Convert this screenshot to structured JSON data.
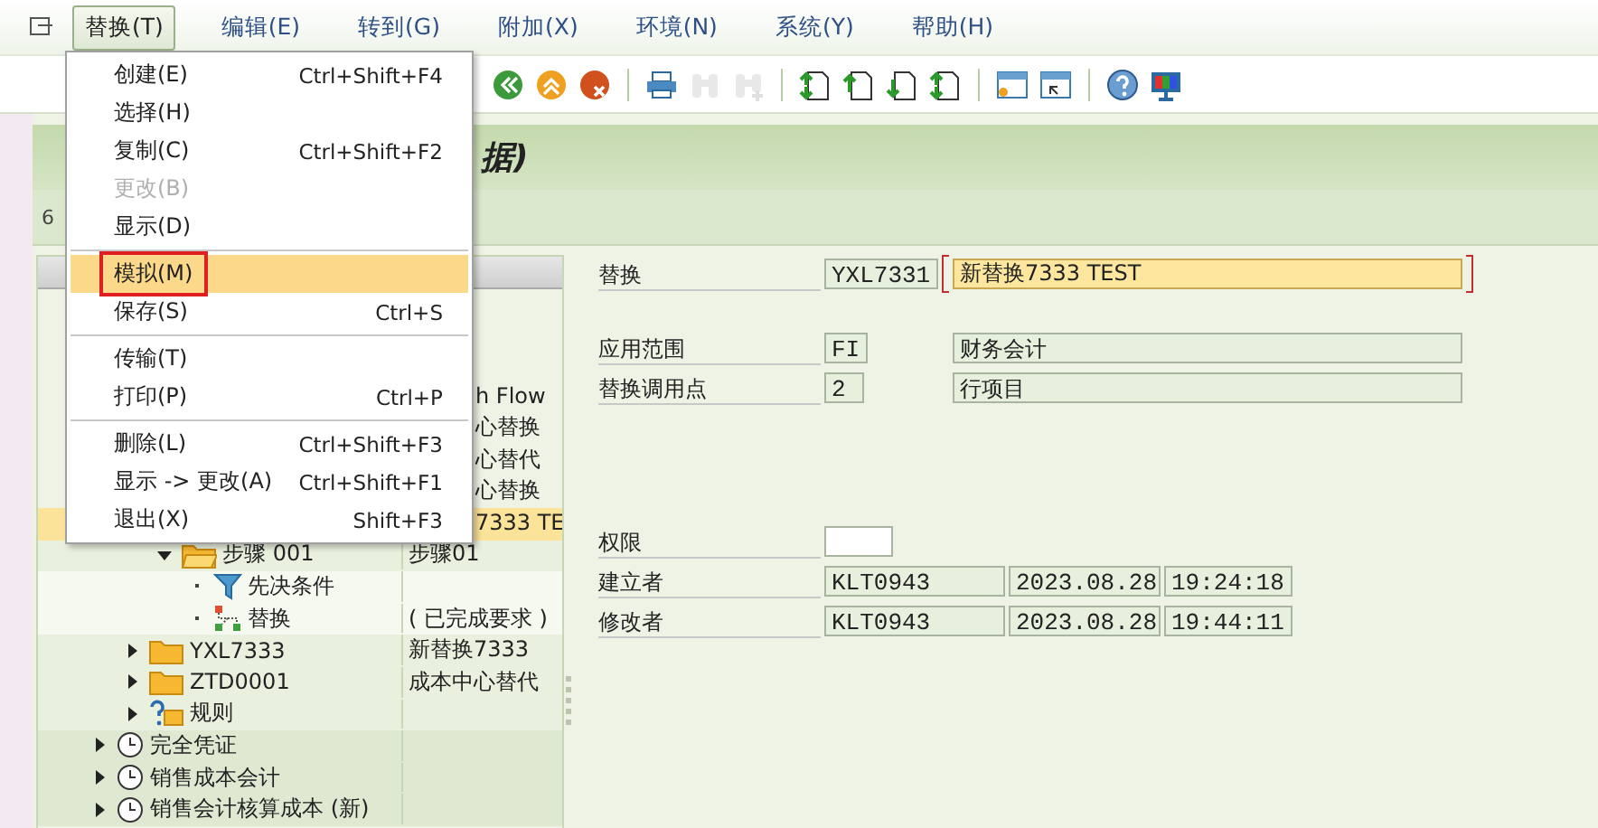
{
  "menu_bar": {
    "items": [
      {
        "label": "替换(T)",
        "selected": true
      },
      {
        "label": "编辑(E)",
        "selected": false
      },
      {
        "label": "转到(G)",
        "selected": false
      },
      {
        "label": "附加(X)",
        "selected": false
      },
      {
        "label": "环境(N)",
        "selected": false
      },
      {
        "label": "系统(Y)",
        "selected": false
      },
      {
        "label": "帮助(H)",
        "selected": false
      }
    ]
  },
  "toolbar": {
    "buttons": [
      {
        "kind": "back",
        "disabled": false
      },
      {
        "kind": "exit",
        "disabled": false
      },
      {
        "kind": "cancel",
        "disabled": false
      },
      {
        "kind": "sep"
      },
      {
        "kind": "print",
        "disabled": false
      },
      {
        "kind": "find",
        "disabled": true
      },
      {
        "kind": "find-next",
        "disabled": true
      },
      {
        "kind": "sep"
      },
      {
        "kind": "first-page",
        "disabled": false
      },
      {
        "kind": "prev-page",
        "disabled": false
      },
      {
        "kind": "next-page",
        "disabled": false
      },
      {
        "kind": "last-page",
        "disabled": false
      },
      {
        "kind": "sep"
      },
      {
        "kind": "new-window",
        "disabled": false
      },
      {
        "kind": "shortcut",
        "disabled": false
      },
      {
        "kind": "sep"
      },
      {
        "kind": "help",
        "disabled": false
      },
      {
        "kind": "layout",
        "disabled": false
      }
    ]
  },
  "title_bar": {
    "title": "据)"
  },
  "app_toolbar": {
    "text": "6"
  },
  "dropdown_menu": {
    "groups": [
      [
        {
          "label": "创建(E)",
          "shortcut": "Ctrl+Shift+F4",
          "disabled": false,
          "selected": false
        },
        {
          "label": "选择(H)",
          "disabled": false,
          "selected": false
        },
        {
          "label": "复制(C)",
          "shortcut": "Ctrl+Shift+F2",
          "disabled": false,
          "selected": false
        },
        {
          "label": "更改(B)",
          "disabled": true,
          "selected": false
        },
        {
          "label": "显示(D)",
          "disabled": false,
          "selected": false
        }
      ],
      [
        {
          "label": "模拟(M)",
          "disabled": false,
          "selected": true
        },
        {
          "label": "保存(S)",
          "shortcut": "Ctrl+S",
          "disabled": false,
          "selected": false
        }
      ],
      [
        {
          "label": "传输(T)",
          "disabled": false,
          "selected": false
        },
        {
          "label": "打印(P)",
          "shortcut": "Ctrl+P",
          "disabled": false,
          "selected": false
        }
      ],
      [
        {
          "label": "删除(L)",
          "shortcut": "Ctrl+Shift+F3",
          "disabled": false,
          "selected": false
        },
        {
          "label": "显示 -> 更改(A)",
          "shortcut": "Ctrl+Shift+F1",
          "disabled": false,
          "selected": false
        },
        {
          "label": "退出(X)",
          "shortcut": "Shift+F3",
          "disabled": false,
          "selected": false
        }
      ]
    ]
  },
  "tree": {
    "items": [
      {
        "kind": "group",
        "selected": false,
        "children": [
          {
            "kind": "covered",
            "text": "h Flow",
            "selected": false
          },
          {
            "kind": "covered",
            "text": "心替换",
            "selected": false
          },
          {
            "kind": "covered",
            "text": "心替代",
            "selected": false
          },
          {
            "kind": "covered",
            "text": "心替换",
            "selected": false
          },
          {
            "kind": "covered",
            "text": "7333 TE",
            "selected": true,
            "children": [
              {
                "kind": "folder",
                "label": "步骤 001",
                "text": "步骤01",
                "expanded": true,
                "selected": false,
                "children": [
                  {
                    "kind": "condition",
                    "label": "先决条件",
                    "selected": false
                  },
                  {
                    "kind": "substitution",
                    "label": "替换",
                    "text": "( 已完成要求 )",
                    "selected": false
                  }
                ]
              }
            ]
          },
          {
            "kind": "folder",
            "label": "YXL7333",
            "text": "新替换7333",
            "expanded": false,
            "selected": false
          },
          {
            "kind": "folder",
            "label": "ZTD0001",
            "text": "成本中心替代",
            "expanded": false,
            "selected": false
          },
          {
            "kind": "rule",
            "label": "规则",
            "expanded": false,
            "selected": false
          }
        ]
      },
      {
        "kind": "clock",
        "label": "完全凭证",
        "expanded": false,
        "selected": false
      },
      {
        "kind": "clock",
        "label": "销售成本会计",
        "expanded": false,
        "selected": false
      },
      {
        "kind": "clock",
        "label": "销售会计核算成本 (新)",
        "expanded": false,
        "selected": false
      }
    ]
  },
  "form": {
    "sections": [
      [
        {
          "label": "替换",
          "fields": [
            {
              "kind": "code",
              "value": "YXL7331"
            },
            {
              "kind": "focused",
              "value": "新替换7333 TEST"
            }
          ]
        }
      ],
      [
        {
          "label": "应用范围",
          "fields": [
            {
              "kind": "code",
              "value": "FI"
            },
            {
              "kind": "description",
              "value": "财务会计"
            }
          ]
        },
        {
          "label": "替换调用点",
          "fields": [
            {
              "kind": "code",
              "value": "2"
            },
            {
              "kind": "description",
              "value": "行项目"
            }
          ]
        }
      ],
      [
        {
          "label": "权限",
          "fields": [
            {
              "kind": "input"
            }
          ]
        },
        {
          "label": "建立者",
          "fields": [
            {
              "kind": "user",
              "value": "KLT0943"
            },
            {
              "kind": "date",
              "value": "2023.08.28"
            },
            {
              "kind": "time",
              "value": "19:24:18"
            }
          ]
        },
        {
          "label": "修改者",
          "fields": [
            {
              "kind": "user",
              "value": "KLT0943"
            },
            {
              "kind": "date",
              "value": "2023.08.28"
            },
            {
              "kind": "time",
              "value": "19:44:11"
            }
          ]
        }
      ]
    ]
  }
}
